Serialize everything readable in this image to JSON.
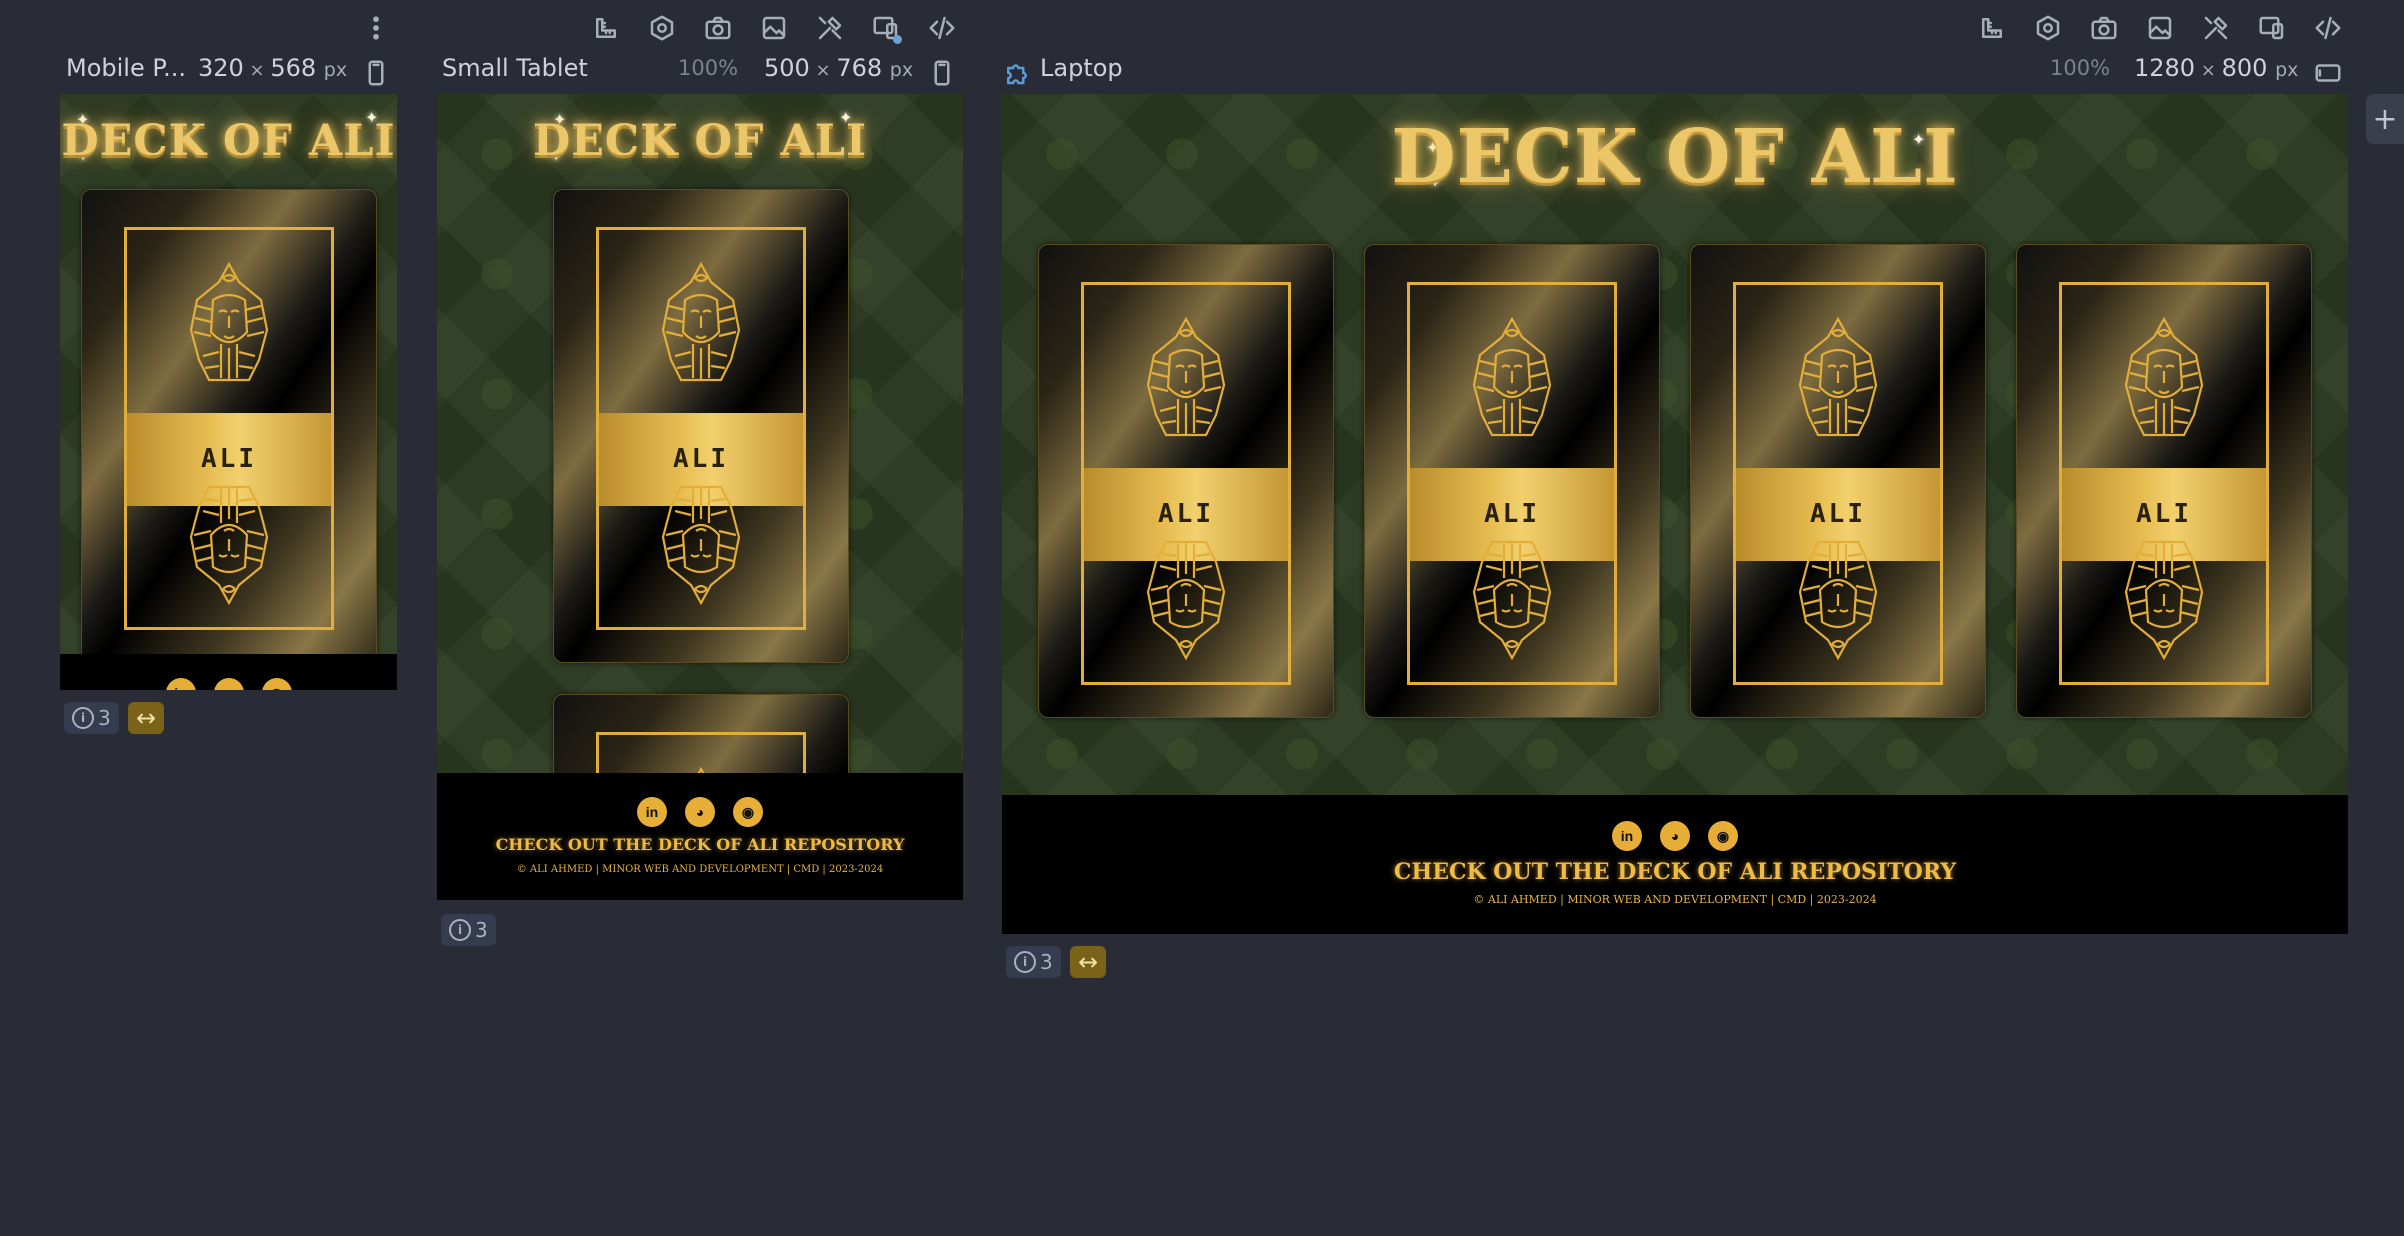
{
  "devices": [
    {
      "name": "Mobile P...",
      "zoom": "",
      "width": "320",
      "height": "568",
      "unit": "px",
      "orientation_icon": "phone-portrait-icon",
      "info_count": "3"
    },
    {
      "name": "Small Tablet",
      "zoom": "100%",
      "width": "500",
      "height": "768",
      "unit": "px",
      "orientation_icon": "phone-portrait-icon",
      "info_count": "3"
    },
    {
      "name": "Laptop",
      "zoom": "100%",
      "width": "1280",
      "height": "800",
      "unit": "px",
      "orientation_icon": "tablet-landscape-icon",
      "info_count": "3"
    }
  ],
  "site": {
    "title": "DECK OF ALI",
    "card_label": "ALI",
    "footer_cta": "CHECK OUT THE DECK OF ALI REPOSITORY",
    "footer_copy": "© ALI AHMED | MINOR WEB AND DEVELOPMENT | CMD | 2023-2024",
    "social": [
      {
        "icon": "linkedin-icon",
        "glyph": "in"
      },
      {
        "icon": "discord-icon",
        "glyph": "◕"
      },
      {
        "icon": "github-icon",
        "glyph": "◉"
      }
    ]
  },
  "toolbar_icons": [
    "ruler-icon",
    "settings-hex-icon",
    "camera-icon",
    "image-icon",
    "tools-icon",
    "responsive-icon",
    "code-icon"
  ],
  "colors": {
    "background": "#292c36",
    "gold": "#e6ad37",
    "felt": "#2c3a21"
  }
}
